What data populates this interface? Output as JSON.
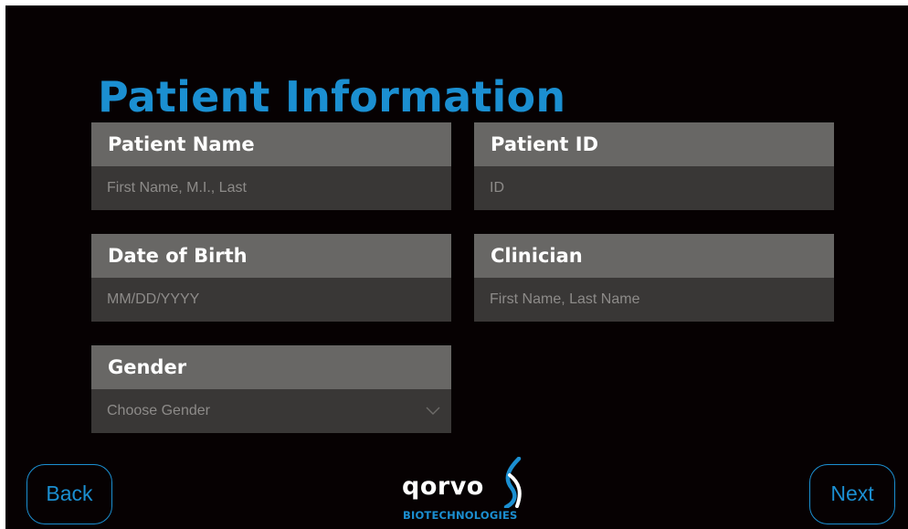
{
  "page": {
    "title": "Patient Information"
  },
  "form": {
    "patient_name": {
      "label": "Patient Name",
      "placeholder": "First Name, M.I., Last"
    },
    "patient_id": {
      "label": "Patient ID",
      "placeholder": "ID"
    },
    "date_of_birth": {
      "label": "Date of Birth",
      "placeholder": "MM/DD/YYYY"
    },
    "clinician": {
      "label": "Clinician",
      "placeholder": "First Name, Last Name"
    },
    "gender": {
      "label": "Gender",
      "placeholder": "Choose Gender"
    }
  },
  "nav": {
    "back_label": "Back",
    "next_label": "Next"
  },
  "logo": {
    "wordmark": "qorvo",
    "subtitle": "BIOTECHNOLOGIES"
  },
  "icons": {
    "dropdown": "chevron-down-icon",
    "logo_mark": "helix-mark-icon"
  },
  "colors": {
    "accent": "#1b8fd1",
    "background": "#060102",
    "label_bg": "#686765",
    "input_bg": "#393736",
    "placeholder": "#8d8b89"
  }
}
